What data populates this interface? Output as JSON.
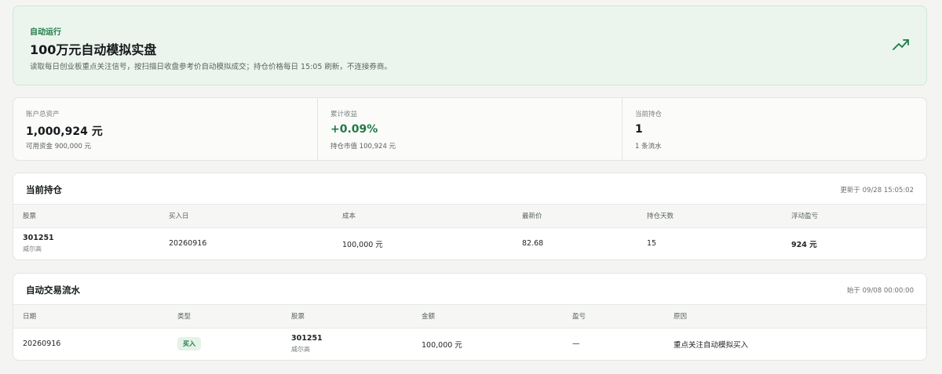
{
  "hero": {
    "tag": "自动运行",
    "title": "100万元自动模拟实盘",
    "description": "读取每日创业板重点关注信号，按扫描日收盘参考价自动模拟成交；持仓价格每日 15:05 刷新，不连接券商。",
    "icon": "trending-up-icon",
    "accent": "#1e7a46"
  },
  "stats": [
    {
      "label": "账户总资产",
      "value": "1,000,924 元",
      "sub": "可用资金 900,000 元"
    },
    {
      "label": "累计收益",
      "value": "+0.09%",
      "sub": "持仓市值 100,924 元"
    },
    {
      "label": "当前持仓",
      "value": "1",
      "sub": "1 条流水"
    }
  ],
  "positions": {
    "title": "当前持仓",
    "updated": "更新于 09/28 15:05:02",
    "columns": [
      "股票",
      "买入日",
      "成本",
      "最新价",
      "持仓天数",
      "浮动盈亏"
    ],
    "rows": [
      {
        "code": "301251",
        "name": "威尔高",
        "buy_date": "20260916",
        "cost": "100,000 元",
        "last_price": "82.68",
        "days": "15",
        "pnl": "924 元"
      }
    ]
  },
  "trades": {
    "title": "自动交易流水",
    "since": "始于 09/08 00:00:00",
    "columns": [
      "日期",
      "类型",
      "股票",
      "金额",
      "盈亏",
      "原因"
    ],
    "rows": [
      {
        "date": "20260916",
        "type": "买入",
        "code": "301251",
        "name": "威尔高",
        "amount": "100,000 元",
        "pnl": "—",
        "reason": "重点关注自动模拟买入"
      }
    ]
  }
}
